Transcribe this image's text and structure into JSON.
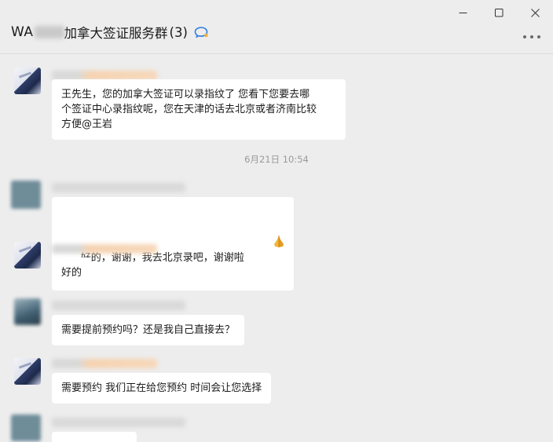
{
  "window": {
    "title_prefix": "WA",
    "title_main": "加拿大签证服务群",
    "member_count": "(3)"
  },
  "colors": {
    "background": "#ededed",
    "bubble": "#ffffff",
    "timestamp": "#9a9a9a"
  },
  "messages": [
    {
      "text": "王先生，您的加拿大签证可以录指纹了 您看下您要去哪\n个签证中心录指纹呢，您在天津的话去北京或者济南比较\n方便@王岩"
    },
    {
      "text": "好的，谢谢，我去北京录吧，谢谢啦"
    },
    {
      "text": "好的"
    },
    {
      "text": "需要提前预约吗？还是我自己直接去？"
    },
    {
      "text": "需要预约 我们正在给您预约 时间会让您选择"
    }
  ],
  "timestamp": "6月21日 10:54",
  "icons": [
    "minimize-icon",
    "maximize-icon",
    "close-icon",
    "group-chat-icon",
    "more-icon",
    "pray-emoji"
  ]
}
